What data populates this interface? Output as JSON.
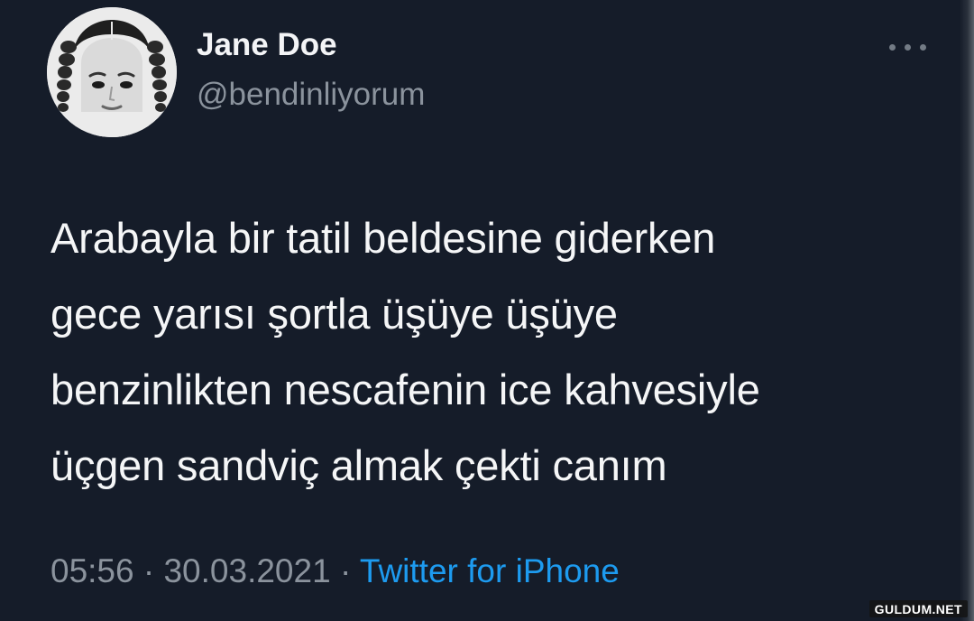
{
  "tweet": {
    "author": {
      "name": "Jane Doe",
      "handle": "@bendinliyorum"
    },
    "text_lines": [
      "Arabayla bir tatil beldesine giderken",
      "gece yarısı şortla üşüye üşüye",
      "benzinlikten nescafenin ice kahvesiyle",
      "üçgen sandviç almak çekti canım"
    ],
    "time": "05:56",
    "separator": "·",
    "date": "30.03.2021",
    "source": "Twitter for iPhone"
  },
  "watermark": "GULDUM.NET",
  "icons": {
    "more": "more-horizontal-icon",
    "avatar": "profile-photo"
  },
  "colors": {
    "background": "#151c29",
    "link": "#1d9bf0",
    "secondary_text": "#8b939d",
    "primary_text": "#f5f6f7"
  }
}
